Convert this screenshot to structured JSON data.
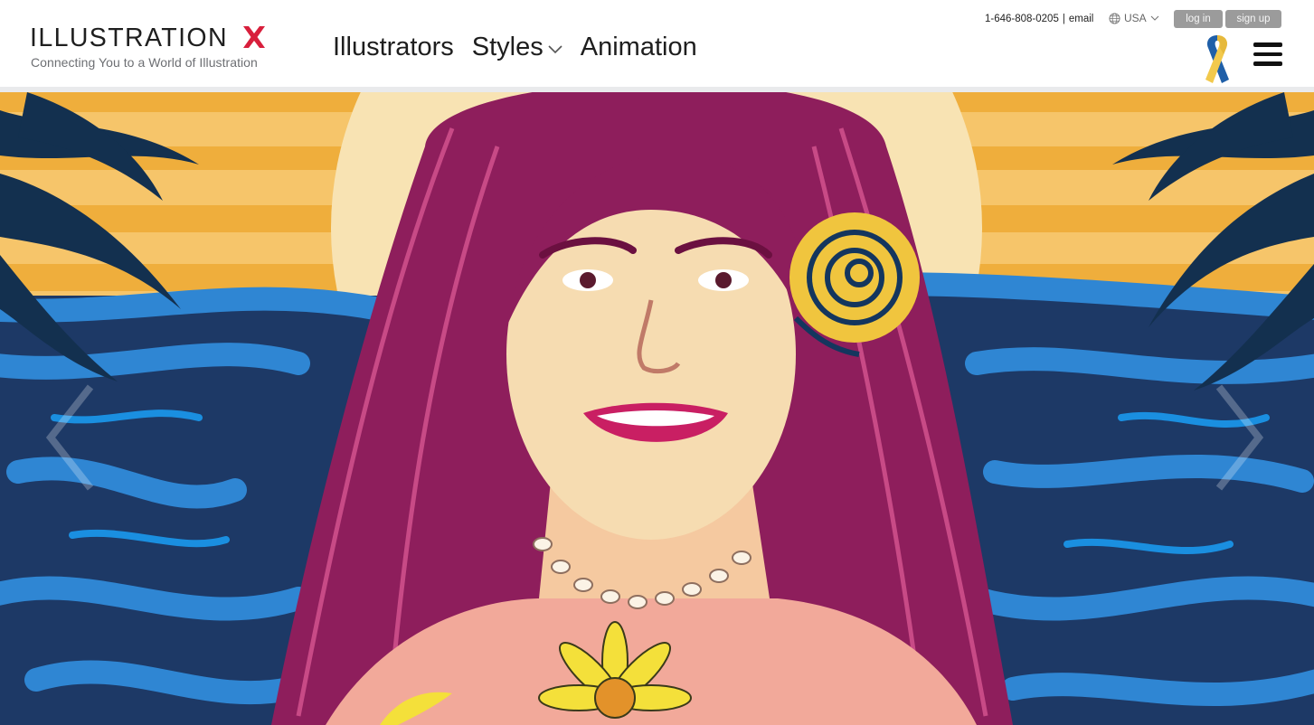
{
  "brand": {
    "name": "ILLUSTRATION",
    "tagline": "Connecting You to a World of Illustration",
    "accent_color": "#d81f3c"
  },
  "topbar": {
    "phone": "1-646-808-0205",
    "separator": "|",
    "email_label": "email",
    "country": "USA"
  },
  "auth": {
    "login_label": "log in",
    "signup_label": "sign up"
  },
  "nav": {
    "illustrators": "Illustrators",
    "styles": "Styles",
    "animation": "Animation"
  },
  "icons": {
    "globe": "globe-icon",
    "chevron": "chevron-down-icon",
    "ribbon": "awareness-ribbon-icon",
    "menu": "hamburger-menu-icon",
    "prev": "chevron-left-icon",
    "next": "chevron-right-icon"
  },
  "colors": {
    "nav_text": "#1e1e1e",
    "button_bg": "#9b9b9b",
    "ribbon_blue": "#1f5fa8",
    "ribbon_yellow": "#f2c94c"
  },
  "hero": {
    "slide_image": "illustration-portrait-woman-beach-sunset"
  }
}
